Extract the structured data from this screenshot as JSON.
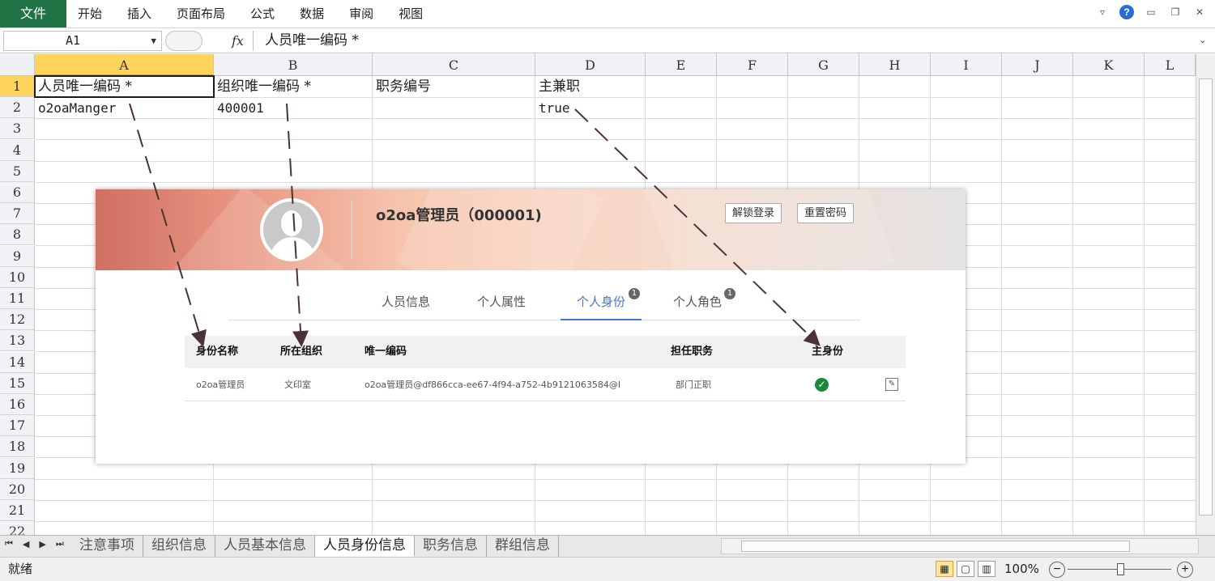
{
  "ribbon": {
    "file_tab": "文件",
    "tabs": [
      "开始",
      "插入",
      "页面布局",
      "公式",
      "数据",
      "审阅",
      "视图"
    ]
  },
  "formula_bar": {
    "name_box": "A1",
    "fx": "fx",
    "content": "人员唯一编码 *"
  },
  "grid": {
    "columns": [
      "A",
      "B",
      "C",
      "D",
      "E",
      "F",
      "G",
      "H",
      "I",
      "J",
      "K",
      "L"
    ],
    "rows": [
      "1",
      "2",
      "3",
      "4",
      "5",
      "6",
      "7",
      "8",
      "9",
      "10",
      "11",
      "12",
      "13",
      "14",
      "15",
      "16",
      "17",
      "18",
      "19",
      "20",
      "21",
      "22"
    ],
    "cells": {
      "A1": "人员唯一编码 *",
      "B1": "组织唯一编码 *",
      "C1": "职务编号",
      "D1": "主兼职",
      "A2": "o2oaManger",
      "B2": "400001",
      "D2": "true"
    }
  },
  "sheet_tabs": [
    "注意事项",
    "组织信息",
    "人员基本信息",
    "人员身份信息",
    "职务信息",
    "群组信息"
  ],
  "active_sheet": "人员身份信息",
  "status": {
    "ready": "就绪",
    "zoom": "100%"
  },
  "card": {
    "person_name": "o2oa管理员（000001)",
    "unlock_button": "解锁登录",
    "reset_password_button": "重置密码",
    "tabs": [
      {
        "label": "人员信息",
        "badge": ""
      },
      {
        "label": "个人属性",
        "badge": ""
      },
      {
        "label": "个人身份",
        "badge": "1"
      },
      {
        "label": "个人角色",
        "badge": "1"
      }
    ],
    "active_tab": "个人身份",
    "table": {
      "headers": [
        "身份名称",
        "所在组织",
        "唯一编码",
        "担任职务",
        "主身份"
      ],
      "row": {
        "identity_name": "o2oa管理员",
        "org": "文印室",
        "unique_code": "o2oa管理员@df866cca-ee67-4f94-a752-4b9121063584@I",
        "duty": "部门正职",
        "is_main": true
      }
    }
  },
  "colors": {
    "excel_green": "#217346",
    "selected_header": "#ffd35c",
    "tab_active": "#4a76c0",
    "check_green": "#1a8a3a",
    "arrow": "#4a3236"
  },
  "icons": [
    "help-icon",
    "minimize-icon",
    "restore-icon",
    "close-icon",
    "fx-icon",
    "check-icon",
    "edit-icon",
    "avatar-icon"
  ]
}
